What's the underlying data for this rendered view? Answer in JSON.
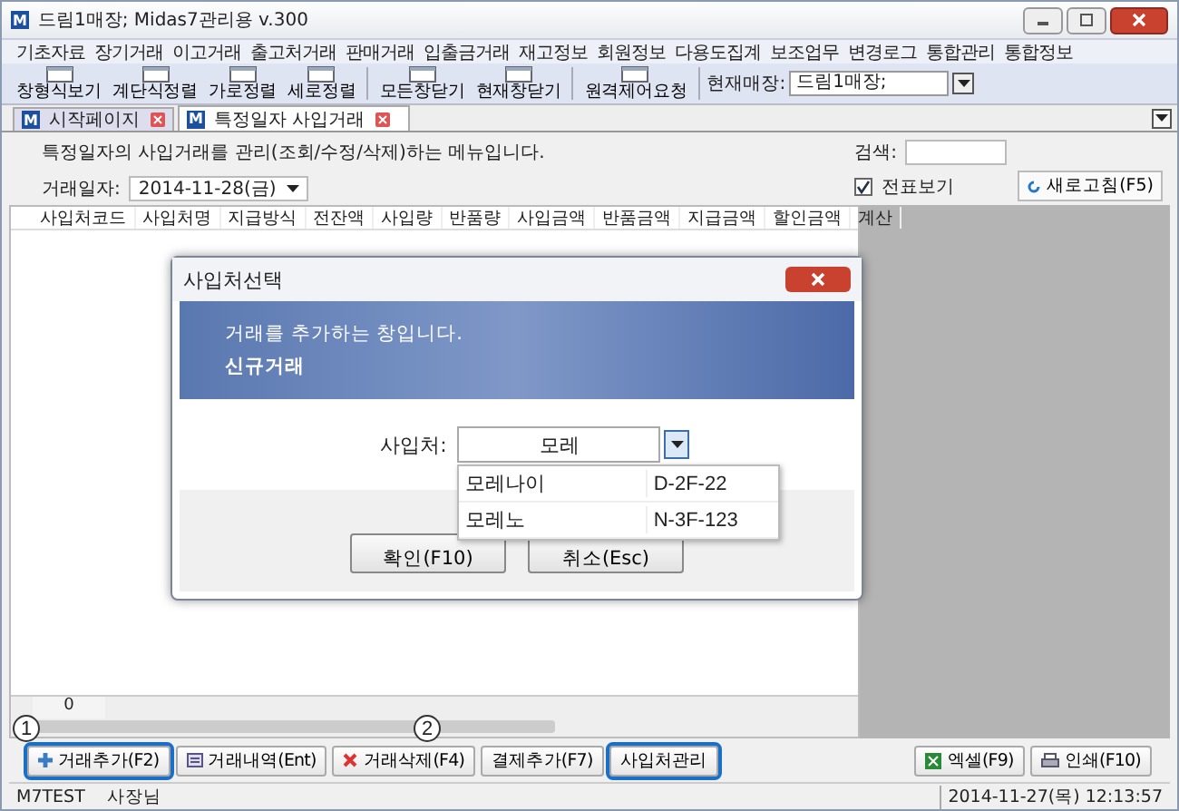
{
  "window": {
    "logo": "M",
    "title": "드림1매장; Midas7관리용 v.300"
  },
  "menu": [
    "기초자료",
    "장기거래",
    "이고거래",
    "출고처거래",
    "판매거래",
    "입출금거래",
    "재고정보",
    "회원정보",
    "다용도집계",
    "보조업무",
    "변경로그",
    "통합관리",
    "통합정보"
  ],
  "toolbar": {
    "buttons": [
      {
        "label": "창형식보기"
      },
      {
        "label": "계단식정렬"
      },
      {
        "label": "가로정렬"
      },
      {
        "label": "세로정렬"
      },
      {
        "label": "모든창닫기"
      },
      {
        "label": "현재창닫기"
      },
      {
        "label": "원격제어요청"
      }
    ],
    "store_label": "현재매장:",
    "store_value": "드림1매장;"
  },
  "tabs": [
    {
      "logo": "M",
      "label": "시작페이지",
      "selected": false
    },
    {
      "logo": "M",
      "label": "특정일자 사입거래",
      "selected": true
    }
  ],
  "page": {
    "description": "특정일자의 사입거래를 관리(조회/수정/삭제)하는 메뉴입니다.",
    "date_label": "거래일자:",
    "date_value": "2014-11-28(금)",
    "search_label": "검색:",
    "voucher_label": "전표보기",
    "voucher_checked": true,
    "refresh_button": "새로고침(F5)"
  },
  "table": {
    "columns": [
      "사입처코드",
      "사입처명",
      "지급방식",
      "전잔액",
      "사입량",
      "반품량",
      "사입금액",
      "반품금액",
      "지급금액",
      "할인금액",
      "계산"
    ],
    "footer": "0"
  },
  "markers": [
    "1",
    "2"
  ],
  "buttons": [
    {
      "label": "거래추가(F2)",
      "kind": "add",
      "highlighted": true
    },
    {
      "label": "거래내역(Ent)",
      "kind": "list",
      "highlighted": false
    },
    {
      "label": "거래삭제(F4)",
      "kind": "delete",
      "highlighted": false
    },
    {
      "label": "결제추가(F7)",
      "kind": "plain",
      "highlighted": false
    },
    {
      "label": "사입처관리",
      "kind": "plain",
      "highlighted": true
    }
  ],
  "right_buttons": [
    {
      "label": "엑셀(F9)",
      "kind": "excel"
    },
    {
      "label": "인쇄(F10)",
      "kind": "print"
    }
  ],
  "status_bar": {
    "user": "M7TEST",
    "role": "사장님",
    "datetime": "2014-11-27(목) 12:13:57"
  },
  "dialog": {
    "title": "사입처선택",
    "banner_text": "거래를 추가하는 창입니다.",
    "banner_title": "신규거래",
    "field_label": "사입처:",
    "field_value": "모레",
    "options": [
      {
        "name": "모레나이",
        "code": "D-2F-22"
      },
      {
        "name": "모레노",
        "code": "N-3F-123"
      }
    ],
    "buttons": [
      "확인(F10)",
      "취소(Esc)"
    ]
  }
}
